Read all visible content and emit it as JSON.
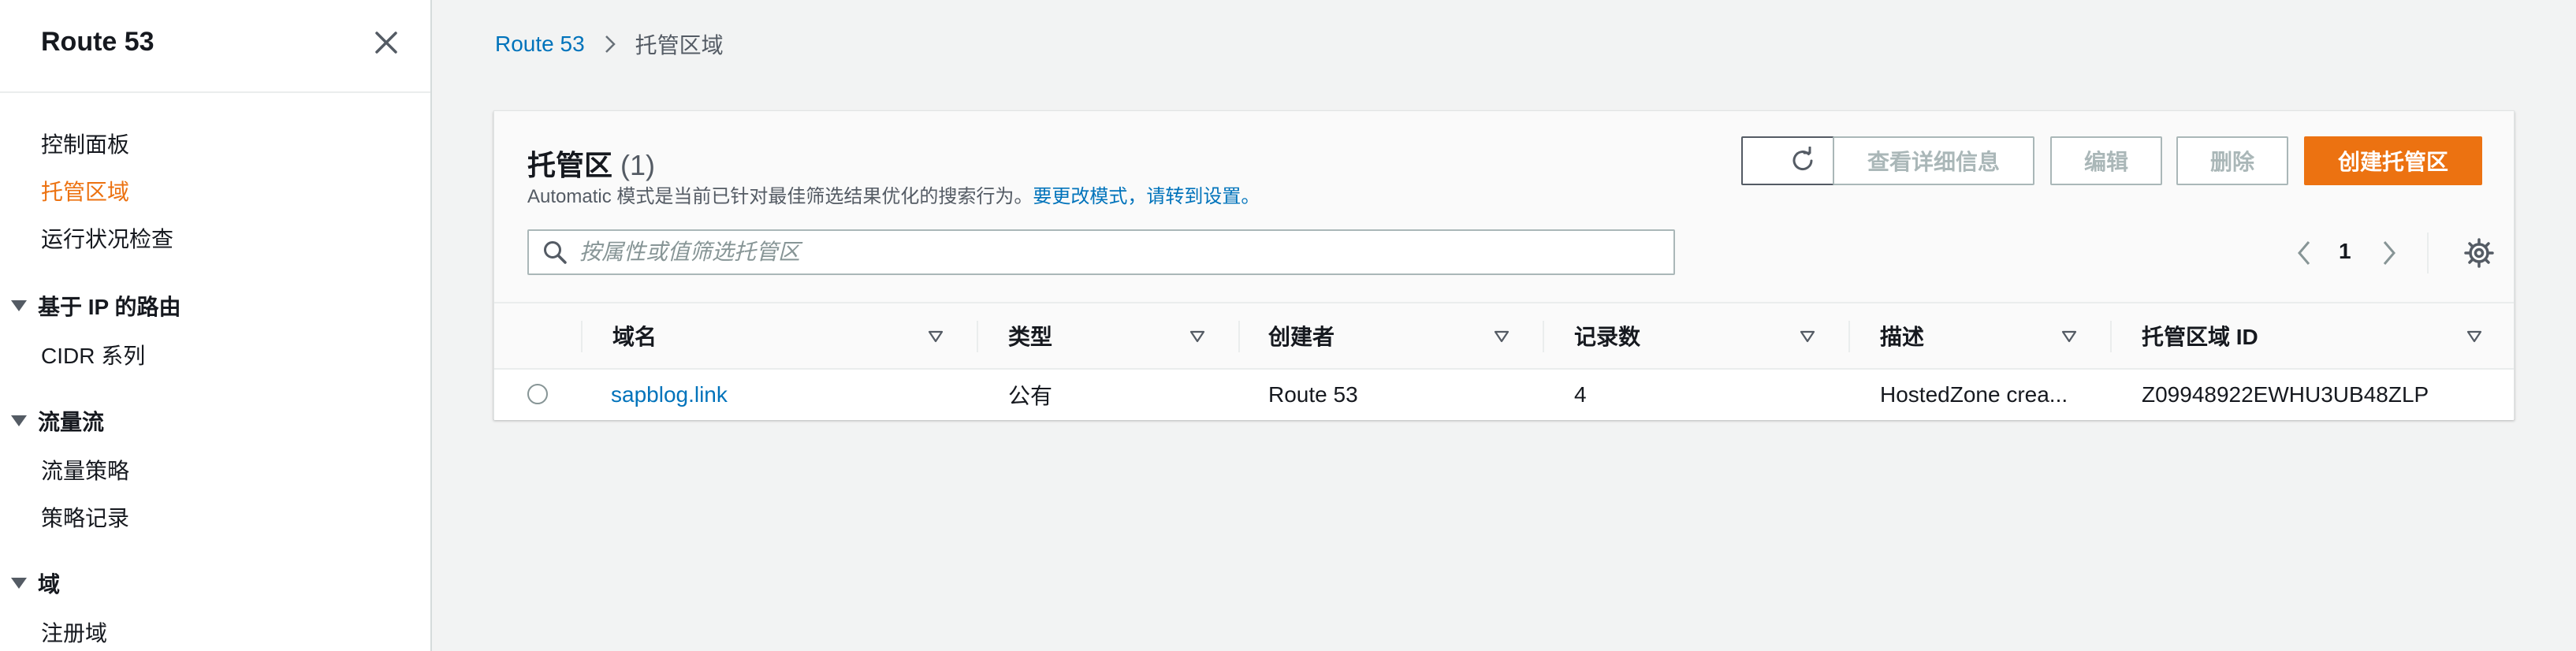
{
  "sidebar": {
    "title": "Route 53",
    "items": [
      {
        "label": "控制面板"
      },
      {
        "label": "托管区域"
      },
      {
        "label": "运行状况检查"
      },
      {
        "label": "CIDR 系列"
      },
      {
        "label": "流量策略"
      },
      {
        "label": "策略记录"
      },
      {
        "label": "注册域"
      }
    ],
    "sections": [
      {
        "label": "基于 IP 的路由"
      },
      {
        "label": "流量流"
      },
      {
        "label": "域"
      }
    ]
  },
  "breadcrumb": {
    "root": "Route 53",
    "current": "托管区域"
  },
  "panel": {
    "title": "托管区",
    "count": "(1)",
    "description": "Automatic 模式是当前已针对最佳筛选结果优化的搜索行为。",
    "description_link": "要更改模式，请转到设置。",
    "buttons": {
      "details": "查看详细信息",
      "edit": "编辑",
      "delete": "删除",
      "create": "创建托管区"
    },
    "search_placeholder": "按属性或值筛选托管区",
    "page": "1"
  },
  "table": {
    "columns": [
      "域名",
      "类型",
      "创建者",
      "记录数",
      "描述",
      "托管区域 ID"
    ],
    "rows": [
      {
        "domain": "sapblog.link",
        "type": "公有",
        "created_by": "Route 53",
        "records": "4",
        "description": "HostedZone crea...",
        "zone_id": "Z09948922EWHU3UB48ZLP"
      }
    ]
  },
  "colors": {
    "accent": "#ec7211",
    "link": "#0073bb",
    "disabled": "#aab7b8"
  },
  "icons": [
    "close-icon",
    "chevron-right-icon",
    "refresh-icon",
    "search-icon",
    "chevron-left-icon",
    "gear-icon",
    "sort-triangle-icon",
    "caret-down-icon"
  ]
}
